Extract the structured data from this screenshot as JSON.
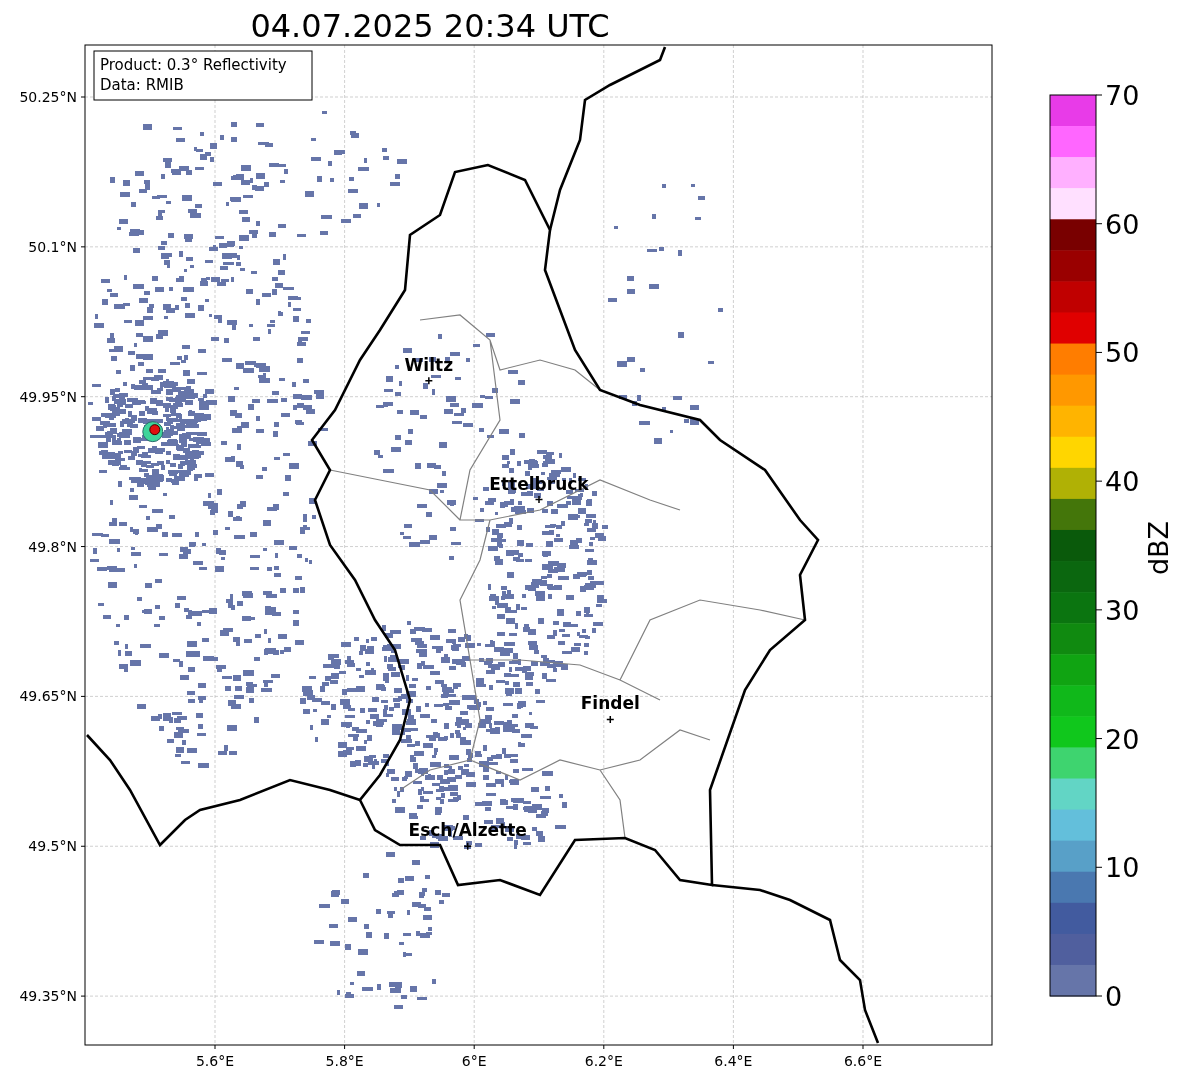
{
  "title": "04.07.2025 20:34 UTC",
  "info_box": [
    "Product: 0.3° Reflectivity",
    "Data: RMIB"
  ],
  "map": {
    "lon_ticks": [
      "5.6°E",
      "5.8°E",
      "6°E",
      "6.2°E",
      "6.4°E",
      "6.6°E"
    ],
    "lat_ticks": [
      "50.25°N",
      "50.1°N",
      "49.95°N",
      "49.8°N",
      "49.65°N",
      "49.5°N",
      "49.35°N"
    ],
    "cities": [
      {
        "name": "Wiltz"
      },
      {
        "name": "Ettelbruck"
      },
      {
        "name": "Findel"
      },
      {
        "name": "Esch/Alzette"
      }
    ]
  },
  "colorbar": {
    "label": "dBZ",
    "ticks": [
      "70",
      "60",
      "50",
      "40",
      "30",
      "20",
      "10",
      "0"
    ],
    "bins": [
      {
        "color": "#e83be8"
      },
      {
        "color": "#ff66ff"
      },
      {
        "color": "#ffb0ff"
      },
      {
        "color": "#ffe0ff"
      },
      {
        "color": "#790000"
      },
      {
        "color": "#9a0000"
      },
      {
        "color": "#c00000"
      },
      {
        "color": "#e00000"
      },
      {
        "color": "#ff7d00"
      },
      {
        "color": "#ff9800"
      },
      {
        "color": "#ffb400"
      },
      {
        "color": "#ffd600"
      },
      {
        "color": "#b0b105"
      },
      {
        "color": "#44760a"
      },
      {
        "color": "#0a5a0b"
      },
      {
        "color": "#0b670f"
      },
      {
        "color": "#0b7510"
      },
      {
        "color": "#108a10"
      },
      {
        "color": "#10a412"
      },
      {
        "color": "#10b81a"
      },
      {
        "color": "#10c71c"
      },
      {
        "color": "#3ed46f"
      },
      {
        "color": "#62d5c5"
      },
      {
        "color": "#63bfdb"
      },
      {
        "color": "#58a0c8"
      },
      {
        "color": "#4a78b0"
      },
      {
        "color": "#425b9f"
      },
      {
        "color": "#505f9e"
      },
      {
        "color": "#6675a9"
      }
    ]
  }
}
